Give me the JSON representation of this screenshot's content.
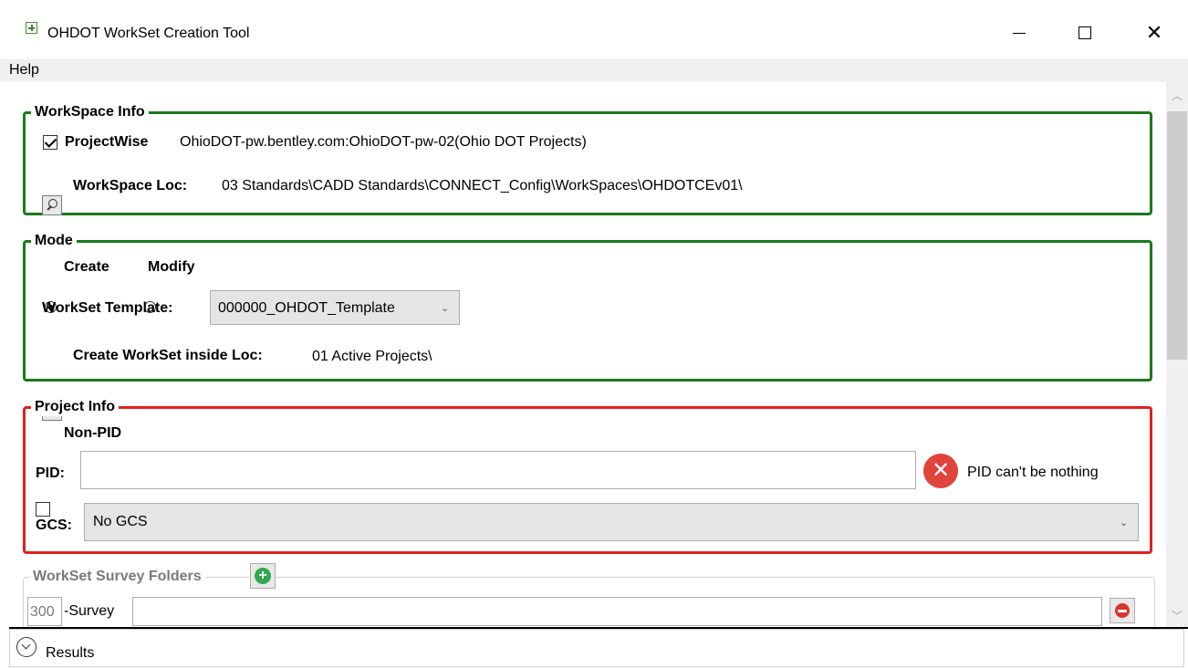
{
  "window": {
    "title": "OHDOT WorkSet Creation Tool",
    "minimize_glyph": "—",
    "close_glyph": "✕"
  },
  "menu": {
    "items": [
      {
        "label": "Help"
      }
    ]
  },
  "workspace_info": {
    "title": "WorkSpace Info",
    "projectwise_checked": true,
    "projectwise_label": "ProjectWise",
    "projectwise_value": "OhioDOT-pw.bentley.com:OhioDOT-pw-02(Ohio DOT Projects)",
    "loc_label": "WorkSpace Loc:",
    "loc_value": "03 Standards\\CADD Standards\\CONNECT_Config\\WorkSpaces\\OHDOTCEv01\\"
  },
  "mode": {
    "title": "Mode",
    "create_label": "Create",
    "modify_label": "Modify",
    "selected": "Create",
    "template_label": "WorkSet Template:",
    "template_value": "000000_OHDOT_Template",
    "create_loc_label": "Create WorkSet inside Loc:",
    "create_loc_value": "01 Active Projects\\"
  },
  "project_info": {
    "title": "Project Info",
    "non_pid_label": "Non-PID",
    "non_pid_checked": false,
    "pid_label": "PID:",
    "pid_value": "",
    "pid_error": "PID can't be nothing",
    "gcs_label": "GCS:",
    "gcs_value": "No GCS"
  },
  "survey_folders": {
    "title": "WorkSet Survey Folders",
    "rows": [
      {
        "number": "300",
        "suffix": "-Survey",
        "value": ""
      }
    ]
  },
  "results": {
    "label": "Results"
  },
  "icons": {
    "app": "app-icon",
    "search": "search-icon",
    "error": "error-icon",
    "add": "add-icon",
    "remove": "remove-icon",
    "expand": "chevron-down-circle-icon"
  },
  "colors": {
    "valid_border": "#1a7a1a",
    "invalid_border": "#e02020",
    "error_icon": "#e0443c",
    "add_icon": "#2fa84f",
    "remove_icon": "#d9342b"
  }
}
